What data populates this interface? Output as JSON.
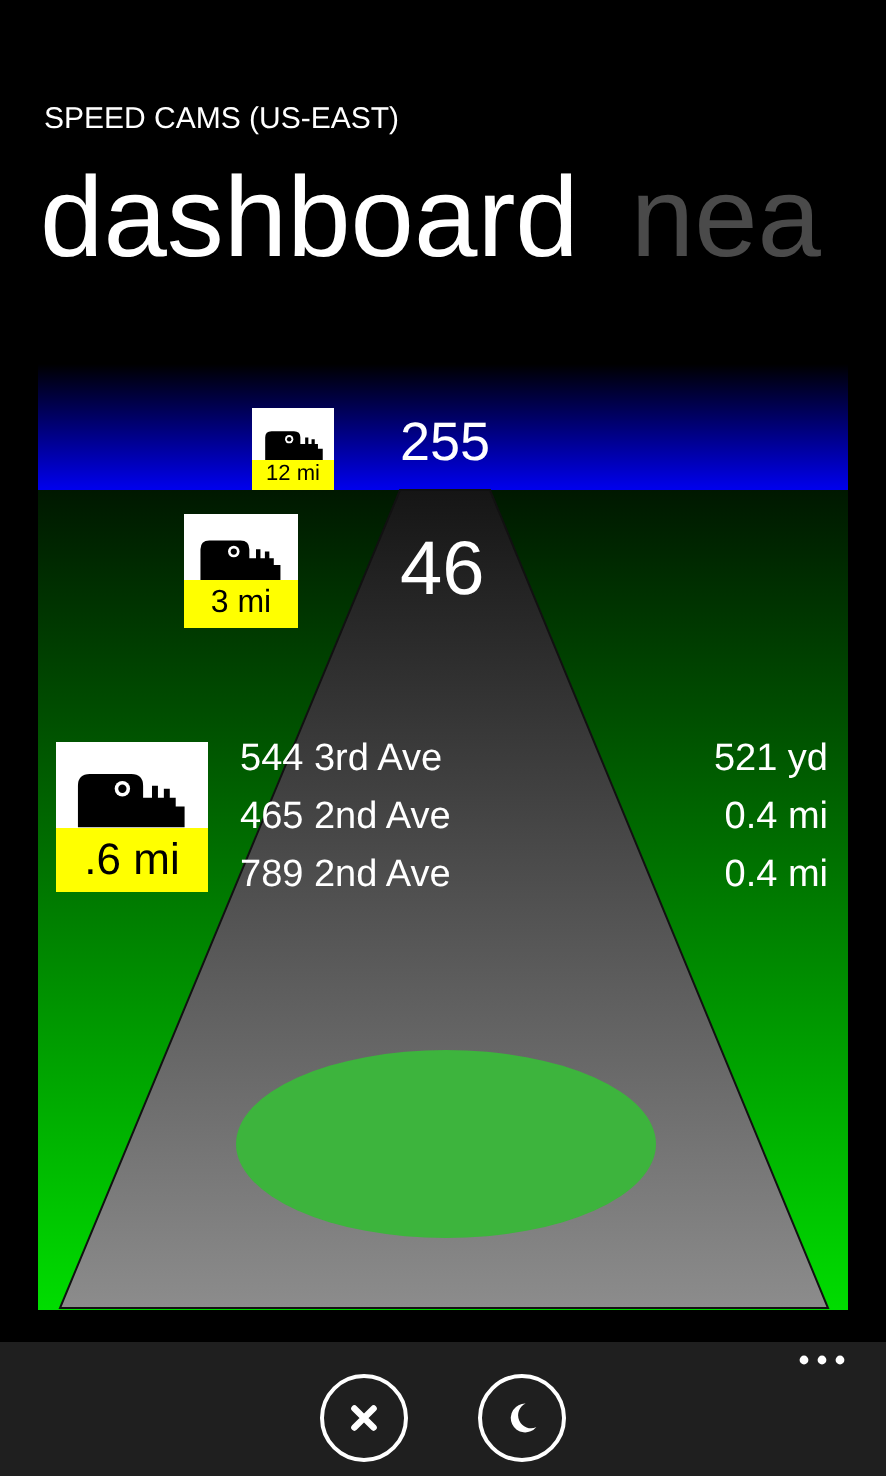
{
  "app_title": "SPEED CAMS (US-EAST)",
  "pivots": [
    {
      "label": "dashboard",
      "selected": true
    },
    {
      "label": "nea",
      "selected": false
    }
  ],
  "dashboard": {
    "far": {
      "distance": "12 mi",
      "speed": "255"
    },
    "next": {
      "distance": "3 mi",
      "speed": "46"
    },
    "nearby": {
      "distance": ".6 mi",
      "cameras": [
        {
          "address": "544 3rd Ave",
          "distance": "521 yd"
        },
        {
          "address": "465 2nd Ave",
          "distance": "0.4 mi"
        },
        {
          "address": "789 2nd Ave",
          "distance": "0.4 mi"
        }
      ]
    }
  },
  "app_bar": {
    "buttons": [
      {
        "kind": "close"
      },
      {
        "kind": "moon"
      }
    ]
  }
}
